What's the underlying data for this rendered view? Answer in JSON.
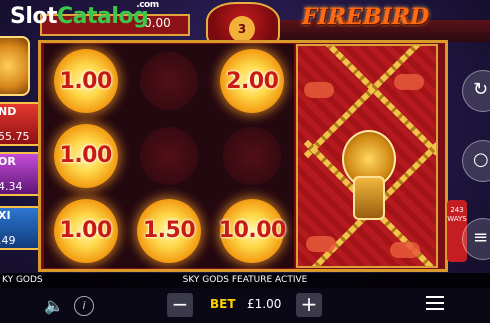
{
  "watermark": {
    "text_slot": "Slot",
    "text_catalog": "Catalog",
    "text_com": ".com"
  },
  "header": {
    "balance_value": "0.00",
    "pot_count": "3",
    "logo": "FIREBIRD"
  },
  "jackpots": [
    {
      "name": "ND",
      "value": "55.75"
    },
    {
      "name": "OR",
      "value": "4.34"
    },
    {
      "name": "XI",
      "value": ".49"
    }
  ],
  "reels": [
    [
      "1.00",
      "",
      "2.00"
    ],
    [
      "1.00",
      "",
      ""
    ],
    [
      "1.00",
      "1.50",
      "10.00"
    ]
  ],
  "ways": {
    "count": "243",
    "label": "WAYS"
  },
  "status": {
    "left": "KY GODS",
    "center": "SKY GODS FEATURE ACTIVE"
  },
  "bet": {
    "label": "BET",
    "value": "£1.00",
    "minus": "−",
    "plus": "+"
  },
  "colors": {
    "accent": "#d99a2c",
    "coin_text": "#c81c12",
    "bet_label": "#ffd000"
  }
}
